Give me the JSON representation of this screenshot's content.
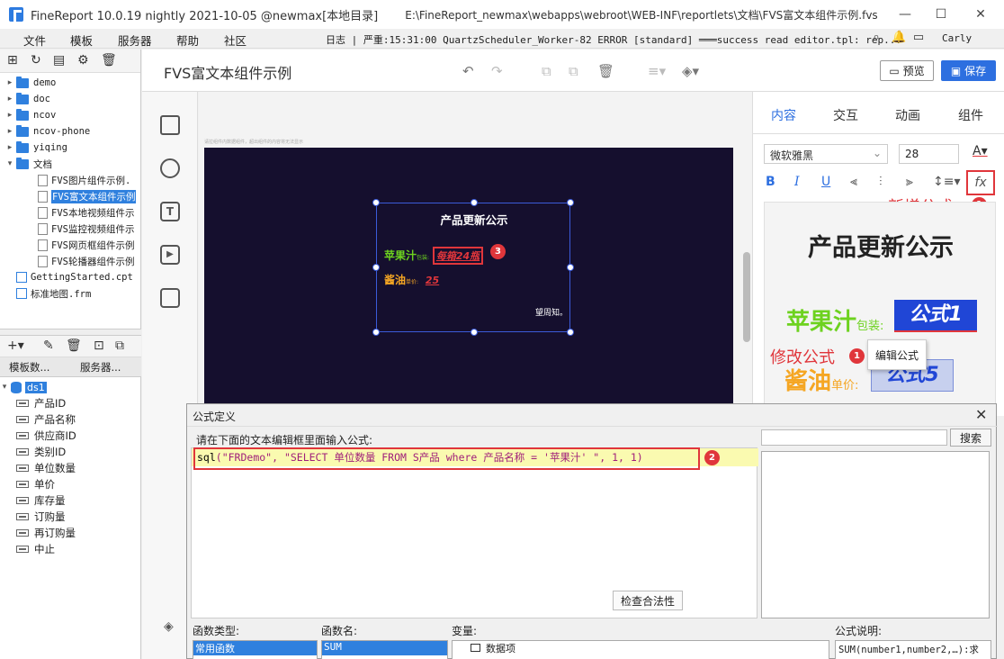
{
  "window": {
    "app_title": "FineReport 10.0.19 nightly 2021-10-05 @newmax[本地目录]",
    "file_path": "E:\\FineReport_newmax\\webapps\\webroot\\WEB-INF\\reportlets\\文档\\FVS富文本组件示例.fvs",
    "minimize": "—",
    "maximize": "☐",
    "close": "✕"
  },
  "menubar": {
    "items": [
      "文件",
      "模板",
      "服务器",
      "帮助",
      "社区"
    ],
    "log_text": "日志 | 严重:15:31:00 QuartzScheduler_Worker-82 ERROR [standard] ═══success read editor.tpl: rep...",
    "user": "Carly"
  },
  "file_tree": {
    "items": [
      {
        "label": "demo",
        "type": "folder",
        "expanded": false
      },
      {
        "label": "doc",
        "type": "folder",
        "expanded": false
      },
      {
        "label": "ncov",
        "type": "folder",
        "expanded": false
      },
      {
        "label": "ncov-phone",
        "type": "folder",
        "expanded": false
      },
      {
        "label": "yiqing",
        "type": "folder",
        "expanded": false
      },
      {
        "label": "文档",
        "type": "folder",
        "expanded": true
      },
      {
        "label": "FVS图片组件示例.",
        "type": "file",
        "indent": 1
      },
      {
        "label": "FVS富文本组件示例",
        "type": "file",
        "indent": 1,
        "selected": true
      },
      {
        "label": "FVS本地视频组件示",
        "type": "file",
        "indent": 1
      },
      {
        "label": "FVS监控视频组件示",
        "type": "file",
        "indent": 1
      },
      {
        "label": "FVS网页框组件示例",
        "type": "file",
        "indent": 1
      },
      {
        "label": "FVS轮播器组件示例",
        "type": "file",
        "indent": 1
      },
      {
        "label": "GettingStarted.cpt",
        "type": "cpt"
      },
      {
        "label": "标准地图.frm",
        "type": "cpt"
      }
    ]
  },
  "dataset_tabs": [
    "模板数...",
    "服务器..."
  ],
  "dataset": {
    "name": "ds1",
    "fields": [
      "产品ID",
      "产品名称",
      "供应商ID",
      "类别ID",
      "单位数量",
      "单价",
      "库存量",
      "订购量",
      "再订购量",
      "中止"
    ]
  },
  "doc": {
    "title": "FVS富文本组件示例",
    "preview_label": "预览",
    "save_label": "保存"
  },
  "canvas": {
    "hint": "请拉组件内数据组件，超出组件的内容将无法显示",
    "notice_title": "产品更新公示",
    "apple_label": "苹果汁",
    "apple_unit": "包装:",
    "apple_value": "每箱24瓶",
    "soy_label": "酱油",
    "soy_unit": "单价:",
    "soy_value": "25",
    "footer": "望周知。",
    "marker3": "3"
  },
  "right_panel": {
    "tabs": [
      "内容",
      "交互",
      "动画",
      "组件"
    ],
    "active_tab": "内容",
    "font": "微软雅黑",
    "size": "28",
    "fx_label": "fx",
    "add_formula_label": "新增公式",
    "modify_formula_label": "修改公式",
    "marker1": "1",
    "edit_formula_label": "编辑公式",
    "preview_title": "产品更新公示",
    "preview_apple": "苹果汁",
    "preview_apple_unit": "包装:",
    "preview_formula1": "公式1",
    "preview_soy": "酱油",
    "preview_soy_unit": "单价:",
    "preview_formula5": "公式5"
  },
  "dialog": {
    "title": "公式定义",
    "prompt": "请在下面的文本编辑框里面输入公式:",
    "code_fn": "sql",
    "code_args": "(\"FRDemo\", \"SELECT 单位数量 FROM S产品 where 产品名称 = '苹果汁' \", 1, 1)",
    "marker2": "2",
    "search_label": "搜索",
    "check_label": "检查合法性",
    "func_type_label": "函数类型:",
    "func_name_label": "函数名:",
    "variable_label": "变量:",
    "formula_desc_label": "公式说明:",
    "func_types": [
      "常用函数"
    ],
    "func_names": [
      "SUM"
    ],
    "variables": [
      "数据项"
    ],
    "help_text": "SUM(number1,number2,…):求"
  },
  "colors": {
    "accent": "#2d6fe0",
    "annotation_red": "#e0363b",
    "canvas_bg": "#150f2e",
    "apple_green": "#6dd21f",
    "soy_orange": "#f5a623"
  }
}
